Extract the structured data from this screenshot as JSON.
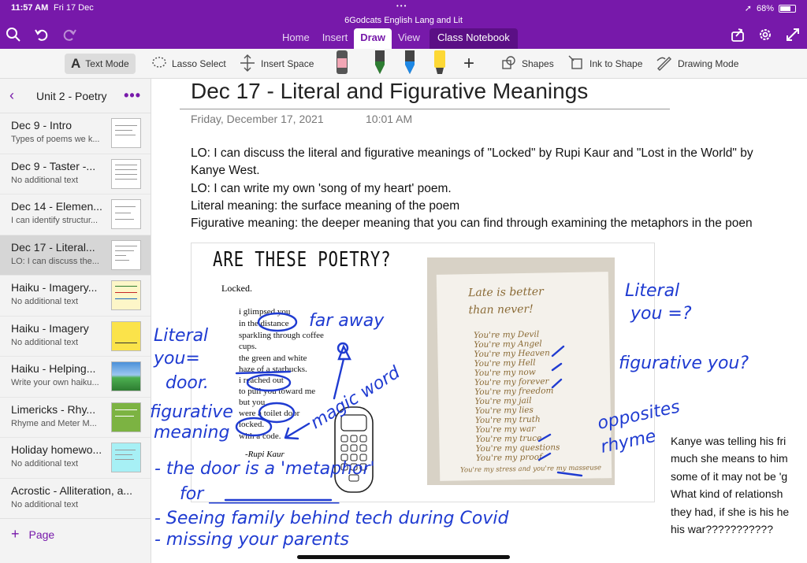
{
  "status": {
    "time": "11:57 AM",
    "date": "Fri 17 Dec",
    "battery": "68%"
  },
  "app": {
    "title": "6Godcats English Lang and Lit"
  },
  "tabs": [
    {
      "label": "Home"
    },
    {
      "label": "Insert"
    },
    {
      "label": "Draw"
    },
    {
      "label": "View"
    },
    {
      "label": "Class Notebook"
    }
  ],
  "ribbon": {
    "text_mode": "Text Mode",
    "lasso_select": "Lasso Select",
    "insert_space": "Insert Space",
    "shapes": "Shapes",
    "ink_to_shape": "Ink to Shape",
    "drawing_mode": "Drawing Mode",
    "pen_colors": [
      "#f2a6b5",
      "#2e7d32",
      "#1e88e5",
      "#fdd835"
    ]
  },
  "sidebar": {
    "section": "Unit 2 - Poetry",
    "add_page": "Page",
    "pages": [
      {
        "title": "Dec 9 - Intro",
        "subtitle": "Types of poems we k..."
      },
      {
        "title": "Dec 9 - Taster -...",
        "subtitle": "No additional text"
      },
      {
        "title": "Dec 14 - Elemen...",
        "subtitle": "I can identify structur..."
      },
      {
        "title": "Dec 17 - Literal...",
        "subtitle": "LO: I can discuss the..."
      },
      {
        "title": "Haiku - Imagery...",
        "subtitle": "No additional text"
      },
      {
        "title": "Haiku - Imagery",
        "subtitle": "No additional text"
      },
      {
        "title": "Haiku - Helping...",
        "subtitle": "Write your own haiku..."
      },
      {
        "title": "Limericks - Rhy...",
        "subtitle": "Rhyme and Meter  M..."
      },
      {
        "title": "Holiday homewo...",
        "subtitle": "No additional text"
      },
      {
        "title": "Acrostic - Alliteration, a...",
        "subtitle": "No additional text"
      }
    ]
  },
  "page": {
    "title": "Dec 17 - Literal and Figurative Meanings",
    "date": "Friday, December 17, 2021",
    "time": "10:01 AM",
    "lines": [
      "LO: I can discuss the literal and figurative meanings of \"Locked\" by Rupi Kaur and \"Lost in the World\" by",
      "Kanye West.",
      "LO: I can write my own 'song of my heart' poem.",
      "Literal meaning: the surface meaning of the poem",
      "Figurative meaning: the deeper meaning that you can find through examining the metaphors in the poen"
    ],
    "worksheet": {
      "heading": "ARE THESE POETRY?",
      "poem_title": "Locked.",
      "poem_lines": [
        "i glimpsed you",
        "in the distance",
        "sparkling through coffee",
        "cups.",
        "the green and white",
        "haze of a starbucks.",
        "i reached out",
        "to pull you toward me",
        "but you",
        "were a toilet door",
        "locked.",
        "with a code."
      ],
      "poem_author": "-Rupi Kaur",
      "letter_lines": [
        "Late is better",
        "than never!",
        "You're my Devil",
        "You're my Angel",
        "You're my Heaven",
        "You're my Hell",
        "You're my now",
        "You're my forever",
        "You're my freedom",
        "You're my jail",
        "You're my lies",
        "You're my truth",
        "You're my war",
        "You're my truce",
        "You're my questions",
        "You're my proof",
        "You're my stress and you're my masseuse"
      ]
    },
    "side_text": [
      "Kanye was telling his fri",
      "much she means to him",
      "some of it may not be 'g",
      "What kind of relationsh",
      "they had, if she is his he",
      "his war???????????"
    ],
    "ink_notes": {
      "far_away": "far away",
      "literal_you_door_1": "Literal",
      "literal_you_door_2": "you=",
      "literal_you_door_3": "door.",
      "magic_word": "magic word",
      "figurative_meaning_1": "figurative",
      "figurative_meaning_2": "meaning",
      "literal_you_q_1": "Literal",
      "literal_you_q_2": "you =?",
      "figurative_you_q": "figurative you?",
      "opposites": "opposites",
      "rhyme": "rhyme",
      "door_metaphor": "- the door is a 'metaphor'",
      "for_blank": "for _______________",
      "seeing_family": "- Seeing family behind tech during Covid",
      "missing_parents": "- missing your parents"
    }
  }
}
